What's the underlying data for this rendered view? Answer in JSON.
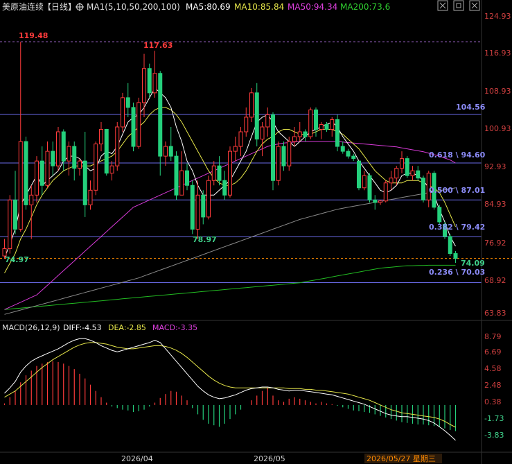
{
  "header": {
    "symbol": "美原油连续",
    "period": "【日线】",
    "ma_label": "MA1(5,10,50,200,100)",
    "ma5": "MA5:80.69",
    "ma10": "MA10:85.84",
    "ma50": "MA50:94.34",
    "ma200": "MA200:73.6"
  },
  "price_axis_labels": [
    "124.93",
    "116.93",
    "108.93",
    "100.93",
    "92.93",
    "84.93",
    "76.92",
    "68.92",
    "63.83"
  ],
  "macd_axis_labels": [
    "8.79",
    "6.69",
    "4.58",
    "2.48",
    "0.38",
    "-1.73",
    "-3.83"
  ],
  "macd_header": {
    "label": "MACD(26,12,9)",
    "diff": "DIFF:-4.53",
    "dea": "DEA:-2.85",
    "macd": "MACD:-3.35"
  },
  "date_labels": [
    "2026/04",
    "2026/05",
    "2026/05/27 星期三"
  ],
  "annotations": {
    "high1": "119.48",
    "high2": "117.63",
    "low1": "78.97",
    "start_low": "74.97",
    "last_low": "74.09",
    "level_104": "104.56",
    "fib618": "0.618 \\ 94.60",
    "fib500": "0.500 \\ 87.01",
    "fib382": "0.382 \\ 79.42",
    "fib236": "0.236 \\ 70.03"
  },
  "colors": {
    "up": "#ff3b3b",
    "down": "#24d07c",
    "ma5": "#ffffff",
    "ma10": "#e6e64a",
    "ma50": "#d83ad8",
    "ma200": "#22bb22",
    "ma100": "#8a8a8a",
    "fib": "#6a6ae8",
    "high_line": "#b070e0",
    "last_price": "#ff8a00"
  },
  "chart_data": {
    "type": "candlestick",
    "y_range": [
      63.83,
      124.93
    ],
    "horizontal_levels": [
      104.56,
      94.6,
      87.01,
      79.42,
      70.03,
      119.48
    ],
    "fib_labels": [
      "0.618",
      "0.500",
      "0.382",
      "0.236"
    ],
    "candles": [
      [
        75.5,
        79.0,
        74.97,
        77.0
      ],
      [
        77.0,
        88.0,
        76.0,
        87.0
      ],
      [
        87.0,
        93.0,
        80.0,
        81.0
      ],
      [
        81.0,
        119.48,
        80.5,
        99.0
      ],
      [
        99.0,
        100.0,
        85.0,
        86.0
      ],
      [
        86.0,
        90.0,
        79.0,
        88.0
      ],
      [
        88.0,
        96.0,
        86.5,
        95.0
      ],
      [
        95.0,
        98.0,
        88.0,
        90.0
      ],
      [
        90.0,
        99.0,
        89.5,
        97.0
      ],
      [
        97.0,
        99.0,
        92.0,
        94.0
      ],
      [
        94.0,
        102.0,
        93.0,
        101.0
      ],
      [
        101.0,
        101.5,
        93.0,
        95.0
      ],
      [
        95.0,
        99.0,
        92.0,
        98.0
      ],
      [
        98.0,
        99.0,
        91.0,
        93.5
      ],
      [
        93.5,
        95.5,
        92.0,
        95.0
      ],
      [
        95.0,
        101.0,
        83.5,
        86.0
      ],
      [
        86.0,
        91.0,
        85.0,
        89.0
      ],
      [
        89.0,
        99.0,
        88.0,
        98.5
      ],
      [
        98.5,
        103.0,
        97.0,
        101.5
      ],
      [
        101.5,
        101.6,
        92.0,
        92.5
      ],
      [
        92.5,
        95.0,
        91.0,
        94.0
      ],
      [
        94.0,
        103.0,
        93.0,
        102.0
      ],
      [
        102.0,
        109.0,
        101.0,
        108.0
      ],
      [
        108.0,
        111.0,
        104.0,
        106.0
      ],
      [
        106.0,
        107.0,
        97.0,
        98.0
      ],
      [
        98.0,
        108.0,
        97.5,
        107.0
      ],
      [
        107.0,
        117.0,
        104.0,
        114.0
      ],
      [
        114.0,
        115.0,
        108.0,
        109.0
      ],
      [
        109.0,
        117.63,
        108.0,
        113.0
      ],
      [
        113.0,
        113.5,
        92.0,
        96.0
      ],
      [
        96.0,
        99.0,
        94.0,
        98.0
      ],
      [
        98.0,
        102.0,
        95.0,
        96.0
      ],
      [
        96.0,
        97.0,
        87.0,
        88.0
      ],
      [
        88.0,
        97.0,
        88.0,
        93.0
      ],
      [
        93.0,
        94.5,
        89.0,
        90.0
      ],
      [
        90.0,
        91.0,
        80.0,
        81.0
      ],
      [
        81.0,
        91.0,
        78.97,
        88.0
      ],
      [
        88.0,
        89.0,
        82.0,
        83.5
      ],
      [
        83.5,
        92.0,
        83.0,
        91.0
      ],
      [
        91.0,
        95.0,
        90.0,
        94.0
      ],
      [
        94.0,
        96.0,
        90.0,
        91.0
      ],
      [
        91.0,
        93.0,
        87.0,
        88.0
      ],
      [
        88.0,
        98.0,
        87.5,
        97.0
      ],
      [
        97.0,
        100.0,
        95.0,
        98.0
      ],
      [
        98.0,
        102.0,
        96.0,
        101.0
      ],
      [
        101.0,
        106.0,
        100.0,
        104.0
      ],
      [
        104.0,
        110.0,
        103.0,
        109.0
      ],
      [
        109.0,
        111.0,
        98.0,
        99.5
      ],
      [
        99.5,
        103.0,
        96.0,
        102.0
      ],
      [
        102.0,
        106.0,
        100.0,
        104.5
      ],
      [
        104.5,
        105.0,
        89.0,
        91.0
      ],
      [
        91.0,
        99.0,
        90.0,
        98.0
      ],
      [
        98.0,
        99.0,
        93.0,
        94.0
      ],
      [
        94.0,
        100.0,
        93.0,
        99.0
      ],
      [
        99.0,
        102.0,
        98.0,
        100.0
      ],
      [
        100.0,
        103.0,
        99.0,
        101.0
      ],
      [
        101.0,
        101.5,
        99.0,
        100.0
      ],
      [
        100.0,
        106.0,
        99.5,
        105.5
      ],
      [
        105.5,
        106.0,
        100.0,
        101.5
      ],
      [
        101.5,
        103.0,
        99.5,
        102.5
      ],
      [
        102.5,
        103.0,
        101.0,
        101.5
      ],
      [
        101.5,
        104.0,
        100.0,
        103.5
      ],
      [
        103.5,
        104.5,
        97.0,
        98.0
      ],
      [
        98.0,
        99.0,
        96.5,
        97.0
      ],
      [
        97.0,
        97.5,
        95.5,
        96.0
      ],
      [
        96.0,
        96.5,
        95.0,
        95.5
      ],
      [
        95.0,
        92.0,
        89.0,
        89.5
      ],
      [
        89.5,
        93.0,
        89.0,
        92.0
      ],
      [
        92.0,
        92.5,
        86.5,
        87.0
      ],
      [
        87.0,
        88.0,
        85.0,
        86.5
      ],
      [
        86.5,
        87.0,
        86.0,
        86.8
      ],
      [
        86.8,
        91.0,
        86.5,
        90.5
      ],
      [
        90.5,
        93.0,
        89.0,
        91.5
      ],
      [
        91.5,
        94.0,
        90.0,
        93.5
      ],
      [
        93.5,
        97.0,
        92.5,
        95.5
      ],
      [
        95.5,
        96.0,
        91.5,
        92.0
      ],
      [
        92.0,
        94.0,
        91.0,
        93.0
      ],
      [
        93.0,
        94.0,
        91.0,
        91.5
      ],
      [
        91.5,
        92.0,
        86.5,
        87.0
      ],
      [
        87.0,
        93.0,
        85.5,
        92.5
      ],
      [
        92.5,
        93.0,
        85.0,
        85.5
      ],
      [
        85.5,
        86.0,
        82.0,
        82.5
      ],
      [
        82.0,
        82.5,
        79.0,
        79.5
      ],
      [
        79.5,
        80.0,
        75.5,
        76.0
      ],
      [
        76.0,
        76.5,
        74.09,
        75.0
      ]
    ],
    "ma5": [
      75.0,
      78.0,
      81.0,
      86.0,
      88.0,
      90.0,
      92.0,
      90.0,
      91.0,
      92.0,
      93.0,
      95.0,
      96.0,
      96.0,
      95.5,
      94.0,
      93.0,
      93.5,
      96.0,
      97.0,
      96.5,
      98.0,
      100.5,
      103.0,
      104.0,
      104.5,
      106.0,
      108.0,
      110.0,
      109.0,
      108.0,
      106.0,
      102.0,
      99.0,
      95.0,
      93.0,
      90.0,
      88.0,
      88.0,
      88.0,
      89.0,
      90.0,
      91.0,
      93.0,
      95.0,
      97.0,
      100.0,
      103.0,
      104.0,
      104.5,
      103.0,
      101.0,
      100.0,
      99.0,
      98.0,
      99.0,
      100.0,
      101.0,
      101.5,
      102.0,
      102.5,
      103.0,
      102.0,
      100.0,
      98.5,
      97.0,
      95.0,
      93.5,
      92.0,
      90.5,
      89.0,
      88.5,
      89.0,
      90.0,
      92.0,
      92.5,
      92.5,
      92.0,
      91.0,
      89.5,
      88.0,
      85.0,
      82.5,
      79.5,
      77.5
    ],
    "ma10": [
      72.0,
      74.0,
      76.0,
      79.0,
      81.0,
      83.5,
      86.0,
      88.0,
      89.5,
      91.0,
      92.0,
      93.0,
      93.5,
      94.0,
      94.0,
      94.0,
      94.0,
      94.5,
      95.0,
      95.5,
      96.0,
      97.0,
      98.5,
      100.0,
      101.0,
      102.0,
      103.0,
      104.5,
      105.5,
      106.0,
      106.0,
      105.5,
      104.5,
      103.0,
      101.0,
      99.0,
      97.0,
      95.0,
      93.0,
      91.5,
      90.5,
      90.0,
      90.0,
      90.5,
      91.5,
      93.0,
      95.0,
      97.0,
      98.5,
      99.5,
      100.0,
      101.0,
      101.5,
      101.5,
      101.0,
      100.5,
      100.5,
      100.5,
      101.0,
      101.5,
      101.5,
      101.5,
      101.0,
      100.5,
      99.5,
      98.5,
      97.5,
      96.0,
      94.5,
      93.0,
      92.0,
      91.0,
      90.5,
      90.5,
      90.5,
      91.0,
      91.0,
      91.0,
      90.5,
      90.0,
      89.5,
      88.5,
      86.5,
      84.0,
      81.5
    ],
    "ma50": [
      64.5,
      65.0,
      65.5,
      66.0,
      66.5,
      67.0,
      67.5,
      68.5,
      69.5,
      70.5,
      71.5,
      72.5,
      73.5,
      74.5,
      75.5,
      76.5,
      77.5,
      78.5,
      79.5,
      80.5,
      81.5,
      82.5,
      83.5,
      84.5,
      85.5,
      86.0,
      86.5,
      87.0,
      87.5,
      88.0,
      88.5,
      89.0,
      89.5,
      90.0,
      90.5,
      91.0,
      91.5,
      92.0,
      92.5,
      93.0,
      93.5,
      94.0,
      94.5,
      95.0,
      95.5,
      96.0,
      96.5,
      97.0,
      97.5,
      98.0,
      98.3,
      98.5,
      98.7,
      98.8,
      98.9,
      99.0,
      99.0,
      99.0,
      99.0,
      99.0,
      99.0,
      99.0,
      99.0,
      98.9,
      98.8,
      98.7,
      98.6,
      98.5,
      98.4,
      98.3,
      98.2,
      98.1,
      98.0,
      97.9,
      97.7,
      97.5,
      97.3,
      97.1,
      96.9,
      96.6,
      96.3,
      96.0,
      95.6,
      95.2,
      94.6
    ],
    "ma100": [
      63.5,
      63.8,
      64.1,
      64.4,
      64.7,
      65.0,
      65.3,
      65.6,
      65.9,
      66.2,
      66.5,
      66.8,
      67.1,
      67.4,
      67.7,
      68.0,
      68.3,
      68.6,
      68.9,
      69.2,
      69.5,
      69.8,
      70.1,
      70.4,
      70.7,
      71.0,
      71.4,
      71.8,
      72.2,
      72.6,
      73.0,
      73.4,
      73.8,
      74.2,
      74.6,
      75.0,
      75.4,
      75.8,
      76.2,
      76.6,
      77.0,
      77.4,
      77.8,
      78.2,
      78.6,
      79.0,
      79.4,
      79.8,
      80.2,
      80.6,
      81.0,
      81.4,
      81.8,
      82.2,
      82.6,
      83.0,
      83.3,
      83.6,
      83.9,
      84.2,
      84.5,
      84.8,
      85.1,
      85.3,
      85.5,
      85.7,
      85.9,
      86.1,
      86.3,
      86.5,
      86.7,
      86.9,
      87.1,
      87.3,
      87.5,
      87.7,
      87.9,
      88.1,
      88.3,
      88.5,
      88.7,
      88.9,
      89.1,
      89.3,
      89.5
    ],
    "ma200": [
      64.5,
      64.6,
      64.7,
      64.8,
      64.9,
      65.0,
      65.1,
      65.2,
      65.3,
      65.4,
      65.5,
      65.6,
      65.7,
      65.8,
      65.9,
      66.0,
      66.1,
      66.2,
      66.3,
      66.4,
      66.5,
      66.6,
      66.7,
      66.8,
      66.9,
      67.0,
      67.1,
      67.2,
      67.3,
      67.4,
      67.5,
      67.6,
      67.7,
      67.8,
      67.9,
      68.0,
      68.1,
      68.2,
      68.3,
      68.4,
      68.5,
      68.6,
      68.7,
      68.8,
      68.9,
      69.0,
      69.1,
      69.2,
      69.3,
      69.4,
      69.5,
      69.6,
      69.7,
      69.8,
      69.9,
      70.0,
      70.2,
      70.4,
      70.6,
      70.8,
      71.0,
      71.2,
      71.4,
      71.6,
      71.8,
      72.0,
      72.2,
      72.4,
      72.6,
      72.8,
      73.0,
      73.1,
      73.2,
      73.3,
      73.4,
      73.5,
      73.5,
      73.55,
      73.55,
      73.6,
      73.6,
      73.6,
      73.6,
      73.6,
      73.6
    ],
    "macd_range": [
      -4.6,
      9.6
    ],
    "diff": [
      1.5,
      2.2,
      3.0,
      4.2,
      5.0,
      5.6,
      6.0,
      6.3,
      6.6,
      6.9,
      7.2,
      7.6,
      8.0,
      8.3,
      8.5,
      8.5,
      8.3,
      8.0,
      7.6,
      7.3,
      7.0,
      6.8,
      7.0,
      7.2,
      7.4,
      7.6,
      7.8,
      8.0,
      8.3,
      8.0,
      7.2,
      6.4,
      5.6,
      4.8,
      4.0,
      3.2,
      2.4,
      1.8,
      1.3,
      1.0,
      0.8,
      0.9,
      1.1,
      1.3,
      1.6,
      1.9,
      2.1,
      2.2,
      2.3,
      2.3,
      2.2,
      2.0,
      1.9,
      1.8,
      1.9,
      1.9,
      1.8,
      1.7,
      1.6,
      1.5,
      1.4,
      1.3,
      1.1,
      0.9,
      0.7,
      0.5,
      0.3,
      0.1,
      -0.2,
      -0.5,
      -0.8,
      -1.1,
      -1.3,
      -1.4,
      -1.5,
      -1.5,
      -1.6,
      -1.7,
      -1.8,
      -2.0,
      -2.3,
      -2.8,
      -3.3,
      -3.9,
      -4.53
    ],
    "dea": [
      1.0,
      1.4,
      1.8,
      2.4,
      3.0,
      3.6,
      4.2,
      4.8,
      5.3,
      5.8,
      6.2,
      6.6,
      7.0,
      7.4,
      7.7,
      7.9,
      8.0,
      8.0,
      7.9,
      7.8,
      7.6,
      7.4,
      7.3,
      7.2,
      7.2,
      7.3,
      7.4,
      7.5,
      7.6,
      7.6,
      7.5,
      7.3,
      7.0,
      6.6,
      6.1,
      5.5,
      4.9,
      4.3,
      3.7,
      3.2,
      2.8,
      2.5,
      2.3,
      2.2,
      2.2,
      2.2,
      2.2,
      2.2,
      2.2,
      2.2,
      2.2,
      2.2,
      2.2,
      2.1,
      2.1,
      2.1,
      2.0,
      2.0,
      1.9,
      1.9,
      1.8,
      1.7,
      1.6,
      1.5,
      1.4,
      1.2,
      1.0,
      0.8,
      0.6,
      0.3,
      0.0,
      -0.3,
      -0.6,
      -0.8,
      -1.0,
      -1.1,
      -1.2,
      -1.3,
      -1.4,
      -1.5,
      -1.6,
      -1.8,
      -2.1,
      -2.5,
      -2.85
    ],
    "macd": [
      0.2,
      1.0,
      1.8,
      2.9,
      3.8,
      4.4,
      5.0,
      5.3,
      5.5,
      5.6,
      5.5,
      5.3,
      5.0,
      4.6,
      4.0,
      3.4,
      2.6,
      1.8,
      1.0,
      0.3,
      -0.2,
      -0.4,
      -0.6,
      -0.7,
      -0.9,
      -0.8,
      -0.6,
      -0.2,
      0.3,
      0.9,
      1.4,
      1.8,
      1.7,
      1.2,
      0.6,
      -0.4,
      -1.2,
      -1.9,
      -2.4,
      -2.6,
      -2.8,
      -2.4,
      -1.8,
      -1.2,
      -0.6,
      0.0,
      0.6,
      1.2,
      1.8,
      2.2,
      1.2,
      0.6,
      0.4,
      0.8,
      1.0,
      0.8,
      0.6,
      0.4,
      0.2,
      0.4,
      0.2,
      0.1,
      -0.1,
      -0.3,
      -0.5,
      -0.7,
      -0.8,
      -0.9,
      -1.0,
      -1.2,
      -1.4,
      -1.6,
      -1.8,
      -2.0,
      -2.2,
      -2.3,
      -2.4,
      -2.5,
      -2.5,
      -2.6,
      -2.7,
      -2.8,
      -3.0,
      -3.2,
      -3.35
    ]
  }
}
